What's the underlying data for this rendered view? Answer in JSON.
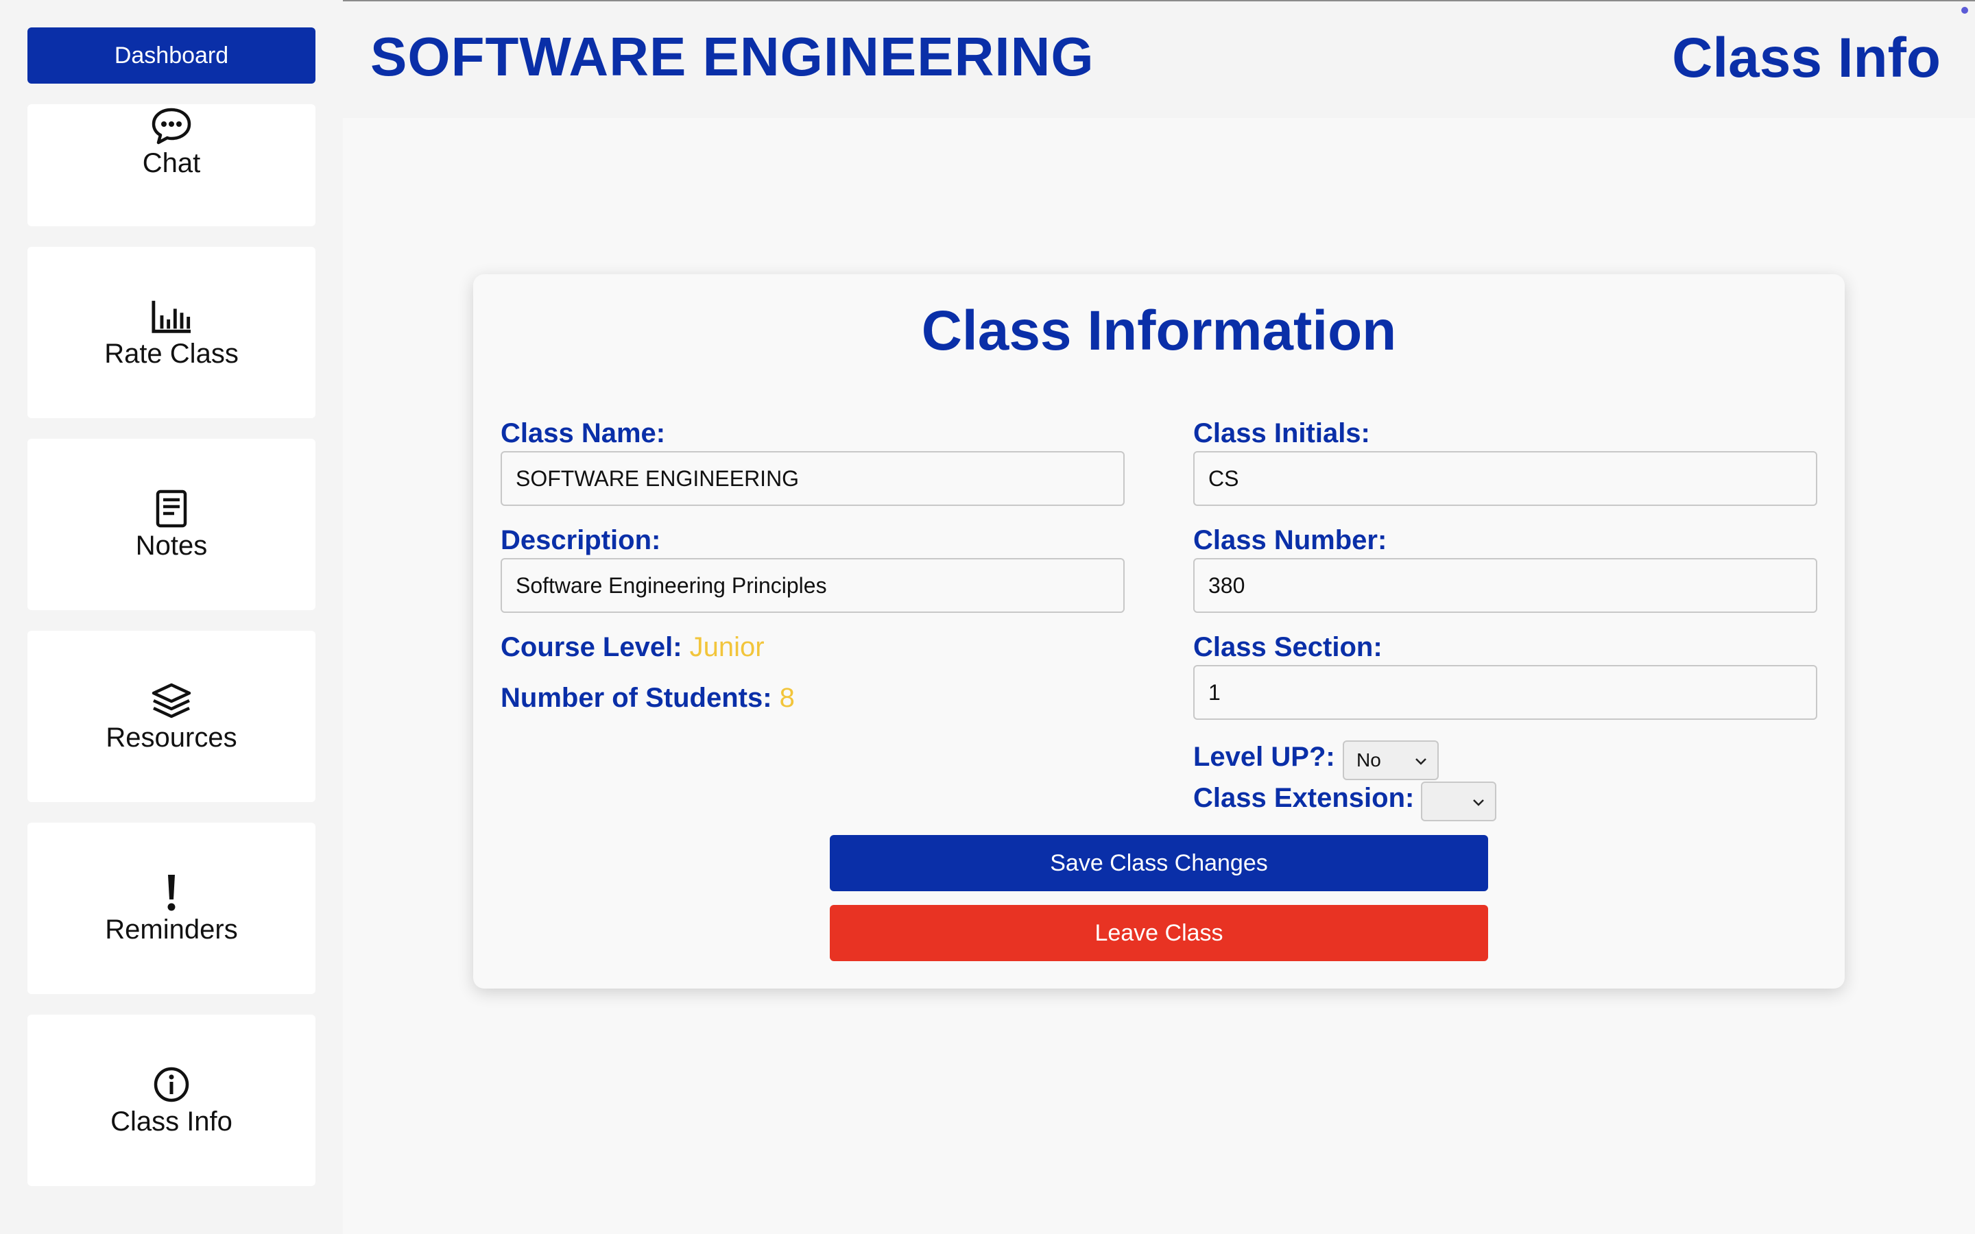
{
  "sidebar": {
    "dashboard_label": "Dashboard",
    "items": [
      {
        "label": "Chat",
        "icon": "chat-bubble-icon"
      },
      {
        "label": "Rate Class",
        "icon": "bar-chart-icon"
      },
      {
        "label": "Notes",
        "icon": "notes-icon"
      },
      {
        "label": "Resources",
        "icon": "layers-icon"
      },
      {
        "label": "Reminders",
        "icon": "exclamation-icon"
      },
      {
        "label": "Class Info",
        "icon": "info-icon"
      }
    ]
  },
  "header": {
    "title": "SOFTWARE ENGINEERING",
    "page_title": "Class Info"
  },
  "form": {
    "title": "Class Information",
    "class_name_label": "Class Name:",
    "class_name_value": "SOFTWARE ENGINEERING",
    "description_label": "Description:",
    "description_value": "Software Engineering Principles",
    "course_level_label": "Course Level:",
    "course_level_value": "Junior",
    "num_students_label": "Number of Students:",
    "num_students_value": "8",
    "class_initials_label": "Class Initials:",
    "class_initials_value": "CS",
    "class_number_label": "Class Number:",
    "class_number_value": "380",
    "class_section_label": "Class Section:",
    "class_section_value": "1",
    "level_up_label": "Level UP?:",
    "level_up_value": "No",
    "class_extension_label": "Class Extension:",
    "class_extension_value": ""
  },
  "actions": {
    "save_label": "Save Class Changes",
    "leave_label": "Leave Class"
  },
  "colors": {
    "primary": "#0a2fa8",
    "danger": "#e83323",
    "accent_value": "#f2c53b"
  }
}
